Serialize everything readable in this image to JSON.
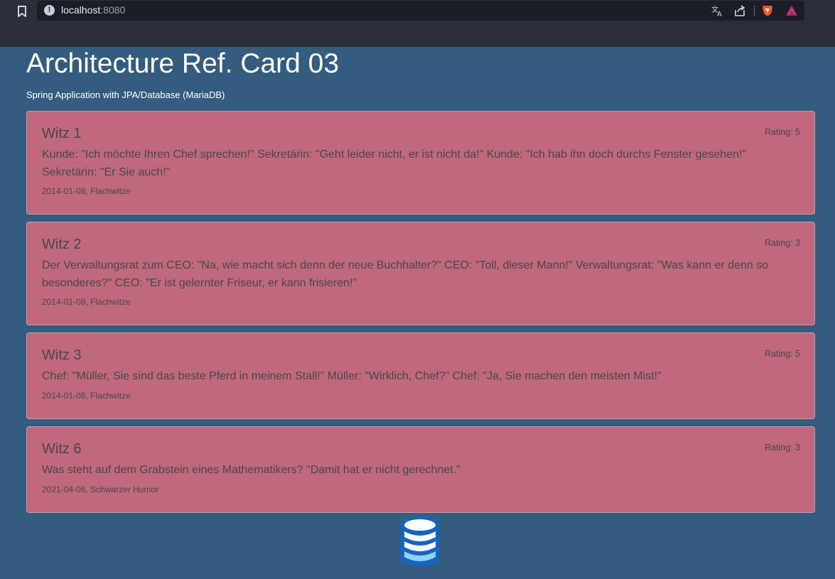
{
  "browser": {
    "url_host": "localhost",
    "url_port": ":8080",
    "icons": [
      "bookmark-icon",
      "site-info-icon",
      "translate-icon",
      "share-icon",
      "brave-shield-icon",
      "brave-rewards-icon"
    ]
  },
  "page": {
    "title": "Architecture Ref. Card 03",
    "subtitle": "Spring Application with JPA/Database (MariaDB)"
  },
  "jokes": [
    {
      "title": "Witz 1",
      "rating": "Rating: 5",
      "text": "Kunde: \"Ich möchte Ihren Chef sprechen!\" Sekretärin: \"Geht leider nicht, er ist nicht da!\" Kunde: \"Ich hab ihn doch durchs Fenster gesehen!\" Sekretärin: \"Er Sie auch!\"",
      "date": "2014-01-08",
      "category": "Flachwitze"
    },
    {
      "title": "Witz 2",
      "rating": "Rating: 3",
      "text": "Der Verwaltungsrat zum CEO: \"Na, wie macht sich denn der neue Buchhalter?\" CEO: \"Toll, dieser Mann!\" Verwaltungsrat: \"Was kann er denn so besonderes?\" CEO: \"Er ist gelernter Friseur, er kann frisieren!\"",
      "date": "2014-01-08",
      "category": "Flachwitze"
    },
    {
      "title": "Witz 3",
      "rating": "Rating: 5",
      "text": "Chef: \"Müller, Sie sind das beste Pferd in meinem Stall!\" Müller: \"Wirklich, Chef?\" Chef: \"Ja, Sie machen den meisten Mist!\"",
      "date": "2014-01-08",
      "category": "Flachwitze"
    },
    {
      "title": "Witz 6",
      "rating": "Rating: 3",
      "text": "Was steht auf dem Grabstein eines Mathematikers? \"Damit hat er nicht gerechnet.\"",
      "date": "2021-04-06",
      "category": "Schwarzer Humor"
    }
  ],
  "colors": {
    "page_background": "#345c7f",
    "card_background": "#c0687d",
    "browser_chrome": "#2b2f3b"
  }
}
